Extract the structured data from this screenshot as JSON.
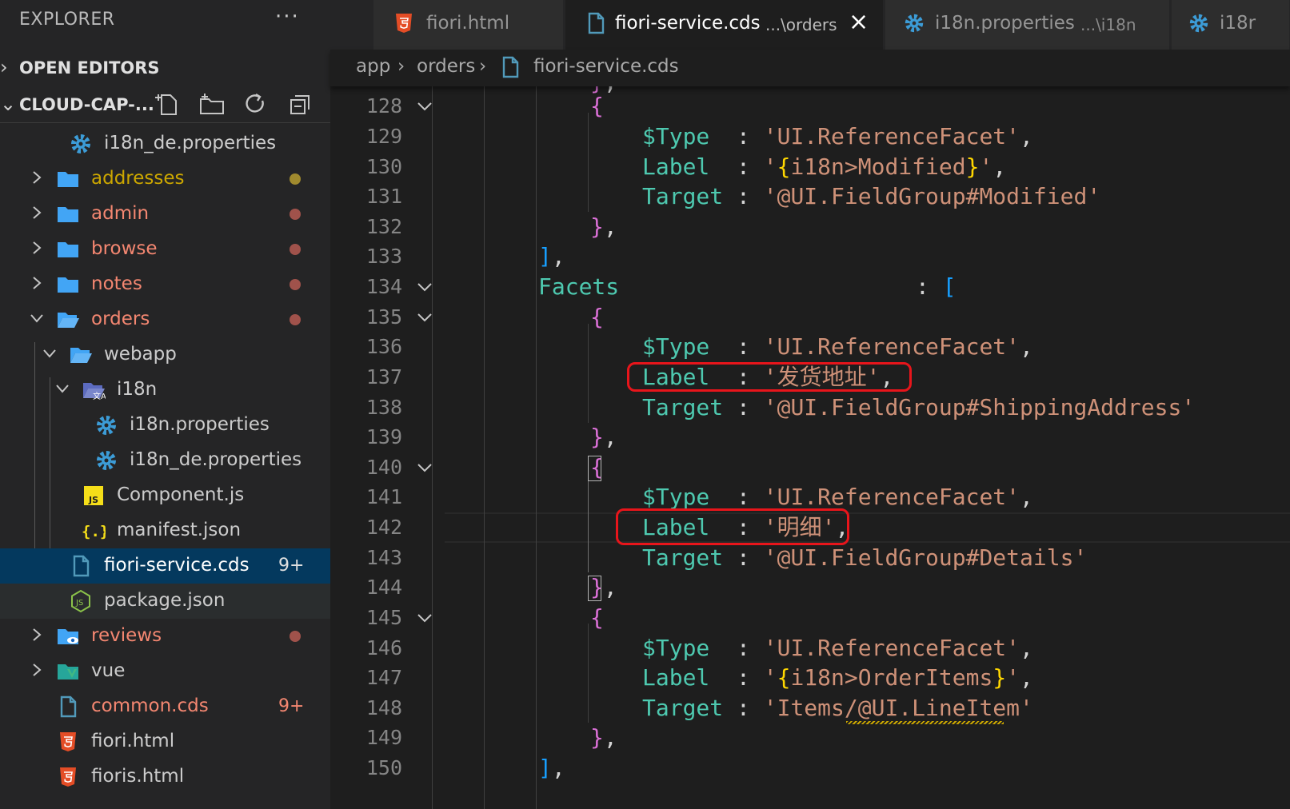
{
  "explorer": {
    "title": "EXPLORER",
    "more": "···",
    "open_editors": "OPEN EDITORS",
    "workspace": "CLOUD-CAP-...",
    "tree": [
      {
        "label": "i18n_de.properties"
      },
      {
        "label": "addresses"
      },
      {
        "label": "admin"
      },
      {
        "label": "browse"
      },
      {
        "label": "notes"
      },
      {
        "label": "orders"
      },
      {
        "label": "webapp"
      },
      {
        "label": "i18n"
      },
      {
        "label": "i18n.properties"
      },
      {
        "label": "i18n_de.properties"
      },
      {
        "label": "Component.js"
      },
      {
        "label": "manifest.json"
      },
      {
        "label": "fiori-service.cds",
        "badge": "9+"
      },
      {
        "label": "package.json"
      },
      {
        "label": "reviews"
      },
      {
        "label": "vue"
      },
      {
        "label": "common.cds",
        "badge": "9+"
      },
      {
        "label": "fiori.html"
      },
      {
        "label": "fioris.html"
      }
    ]
  },
  "tabs": [
    {
      "name": "fiori.html",
      "desc": ""
    },
    {
      "name": "fiori-service.cds",
      "desc": "...\\orders"
    },
    {
      "name": "i18n.properties",
      "desc": "...\\i18n"
    },
    {
      "name": "i18r",
      "desc": ""
    }
  ],
  "breadcrumb": [
    "app",
    "orders",
    "fiori-service.cds"
  ],
  "editor": {
    "line_numbers": [
      "128",
      "129",
      "130",
      "131",
      "132",
      "133",
      "134",
      "135",
      "136",
      "137",
      "138",
      "139",
      "140",
      "141",
      "142",
      "143",
      "144",
      "145",
      "146",
      "147",
      "148",
      "149",
      "150"
    ],
    "lines": {
      "l128": [
        "{"
      ],
      "l129": [
        "$Type",
        ":",
        "'UI.ReferenceFacet'",
        ","
      ],
      "l130": [
        "Label",
        ":",
        "'",
        "{",
        "i18n>Modified",
        "}",
        "'",
        ","
      ],
      "l131": [
        "Target",
        ":",
        "'@UI.FieldGroup#Modified'"
      ],
      "l132": [
        "}",
        ","
      ],
      "l133": [
        "]",
        ","
      ],
      "l134": [
        "Facets",
        ":",
        "["
      ],
      "l135": [
        "{"
      ],
      "l136": [
        "$Type",
        ":",
        "'UI.ReferenceFacet'",
        ","
      ],
      "l137": [
        "Label",
        ":",
        "'发货地址'",
        ","
      ],
      "l138": [
        "Target",
        ":",
        "'@UI.FieldGroup#ShippingAddress'"
      ],
      "l139": [
        "}",
        ","
      ],
      "l140": [
        "{"
      ],
      "l141": [
        "$Type",
        ":",
        "'UI.ReferenceFacet'",
        ","
      ],
      "l142": [
        "Label",
        ":",
        "'明细'",
        ","
      ],
      "l143": [
        "Target",
        ":",
        "'@UI.FieldGroup#Details'"
      ],
      "l144": [
        "}",
        ","
      ],
      "l145": [
        "{"
      ],
      "l146": [
        "$Type",
        ":",
        "'UI.ReferenceFacet'",
        ","
      ],
      "l147": [
        "Label",
        ":",
        "'",
        "{",
        "i18n>OrderItems",
        "}",
        "'",
        ","
      ],
      "l148": [
        "Target",
        ":",
        "'Items/@UI.LineItem'"
      ],
      "l149": [
        "}",
        ","
      ],
      "l150": [
        "]",
        ","
      ]
    }
  },
  "colors": {
    "keyword": "#4ec9b0",
    "string": "#ce9178",
    "bracket_gold": "#ffd700",
    "bracket_blue": "#179fff",
    "bracket_violet": "#da70d6",
    "highlight_box": "#e8151b",
    "selection": "#04395e"
  }
}
